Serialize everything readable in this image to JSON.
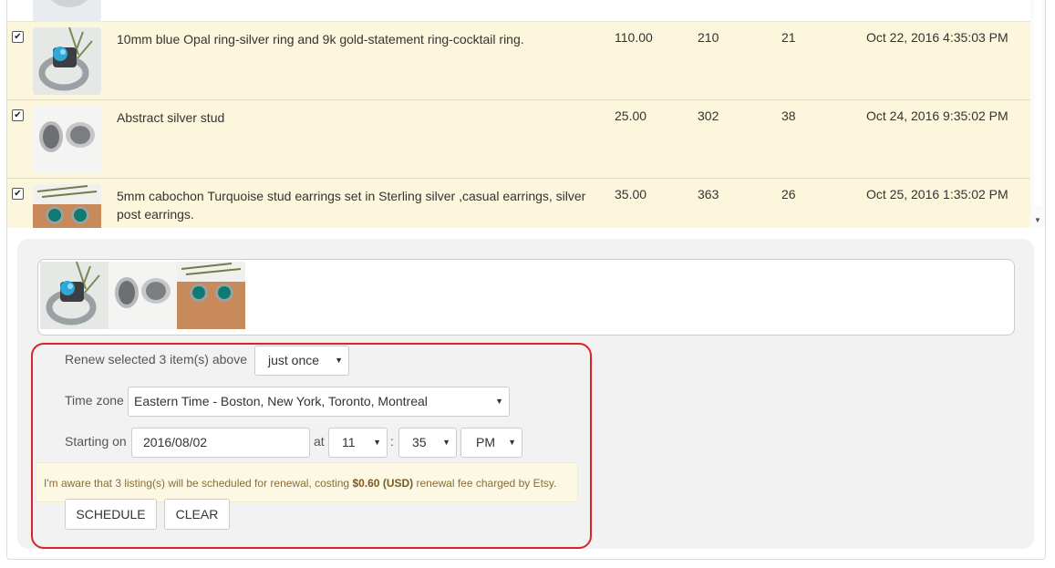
{
  "listings": [
    {
      "title": "",
      "price": "",
      "views": "",
      "favorites": "",
      "date": "",
      "checked": true,
      "thumb": "ring-image",
      "partial": true
    },
    {
      "title": "10mm blue Opal ring-silver ring and 9k gold-statement ring-cocktail ring.",
      "price": "110.00",
      "views": "210",
      "favorites": "21",
      "date": "Oct 22, 2016 4:35:03 PM",
      "checked": true,
      "thumb": "opal-ring-image"
    },
    {
      "title": "Abstract silver stud",
      "price": "25.00",
      "views": "302",
      "favorites": "38",
      "date": "Oct 24, 2016 9:35:02 PM",
      "checked": true,
      "thumb": "silver-stud-image"
    },
    {
      "title": "5mm cabochon Turquoise stud earrings set in Sterling silver ,casual earrings, silver post earrings.",
      "price": "35.00",
      "views": "363",
      "favorites": "26",
      "date": "Oct 25, 2016 1:35:02 PM",
      "checked": true,
      "thumb": "turquoise-stud-image"
    }
  ],
  "schedule": {
    "renew_label": "Renew selected 3 item(s) above",
    "frequency_value": "just once",
    "timezone_label": "Time zone",
    "timezone_value": "Eastern Time - Boston, New York, Toronto, Montreal",
    "starting_label": "Starting on",
    "date_value": "2016/08/02",
    "at_label": "at",
    "hour_value": "11",
    "colon": ":",
    "minute_value": "35",
    "ampm_value": "PM",
    "notice_prefix": "I'm aware that 3 listing(s) will be scheduled for renewal, costing ",
    "notice_cost": "$0.60 (USD)",
    "notice_suffix": " renewal fee charged by Etsy.",
    "schedule_button": "SCHEDULE",
    "clear_button": "CLEAR"
  },
  "icons": {
    "checkbox": "✔",
    "dropdown": "▼",
    "scroll_down": "▼"
  },
  "colors": {
    "row_highlight": "#fcf6dc",
    "accent_border": "#d9232d",
    "notice_bg": "#fcf8e3"
  }
}
